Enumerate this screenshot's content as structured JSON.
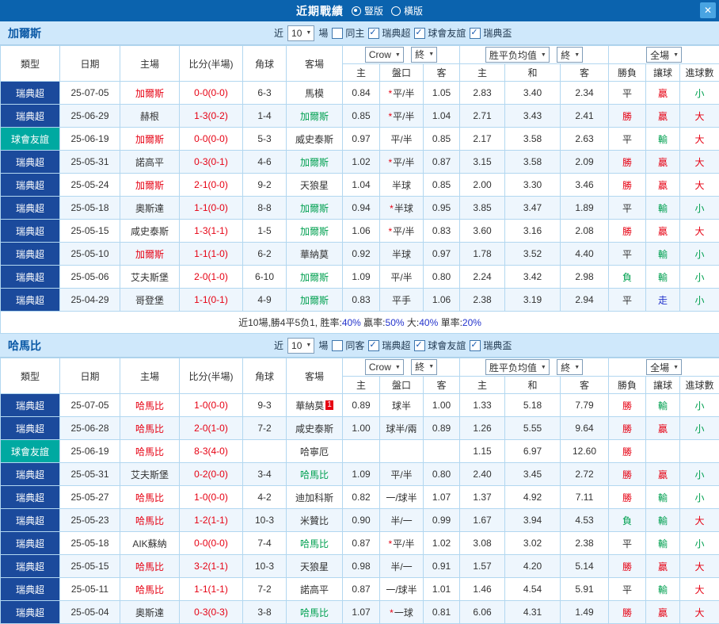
{
  "titlebar": {
    "title": "近期戰績",
    "options": [
      {
        "label": "豎版",
        "selected": true
      },
      {
        "label": "橫版",
        "selected": false
      }
    ],
    "close_label": "✕"
  },
  "filters": {
    "company": "Crow",
    "final_a": "終",
    "avg": "胜平负均值",
    "final_b": "終",
    "scope": "全場"
  },
  "headers": {
    "type": "類型",
    "date": "日期",
    "home": "主場",
    "score": "比分(半場)",
    "corner": "角球",
    "away": "客場",
    "o_home": "主",
    "o_handicap": "盤口",
    "o_away": "客",
    "a_home": "主",
    "a_draw": "和",
    "a_away": "客",
    "result": "勝負",
    "let_ball": "讓球",
    "goals": "進球數"
  },
  "sections": [
    {
      "team": "加爾斯",
      "near": "近",
      "count": "10",
      "unit": "場",
      "same": {
        "label": "同主",
        "checked": false
      },
      "leagues": [
        {
          "label": "瑞典超",
          "checked": true
        },
        {
          "label": "球會友誼",
          "checked": true
        },
        {
          "label": "瑞典盃",
          "checked": true
        }
      ],
      "rows": [
        {
          "league": "瑞典超",
          "friendly": false,
          "date": "25-07-05",
          "home": "加爾斯",
          "home_focus": true,
          "score": "0-0(0-0)",
          "corner": "6-3",
          "away": "馬模",
          "away_focus": false,
          "o": [
            "0.84",
            "*平/半",
            "1.05"
          ],
          "a": [
            "2.83",
            "3.40",
            "2.34"
          ],
          "res": "平",
          "let": "贏",
          "goal": "小"
        },
        {
          "league": "瑞典超",
          "friendly": false,
          "date": "25-06-29",
          "home": "赫根",
          "home_focus": false,
          "score": "1-3(0-2)",
          "corner": "1-4",
          "away": "加爾斯",
          "away_focus": true,
          "o": [
            "0.85",
            "*平/半",
            "1.04"
          ],
          "a": [
            "2.71",
            "3.43",
            "2.41"
          ],
          "res": "勝",
          "let": "贏",
          "goal": "大"
        },
        {
          "league": "球會友誼",
          "friendly": true,
          "date": "25-06-19",
          "home": "加爾斯",
          "home_focus": true,
          "score": "0-0(0-0)",
          "corner": "5-3",
          "away": "威史泰斯",
          "away_focus": false,
          "o": [
            "0.97",
            "平/半",
            "0.85"
          ],
          "a": [
            "2.17",
            "3.58",
            "2.63"
          ],
          "res": "平",
          "let": "輸",
          "goal": "大"
        },
        {
          "league": "瑞典超",
          "friendly": false,
          "date": "25-05-31",
          "home": "諾高平",
          "home_focus": false,
          "score": "0-3(0-1)",
          "corner": "4-6",
          "away": "加爾斯",
          "away_focus": true,
          "o": [
            "1.02",
            "*平/半",
            "0.87"
          ],
          "a": [
            "3.15",
            "3.58",
            "2.09"
          ],
          "res": "勝",
          "let": "贏",
          "goal": "大"
        },
        {
          "league": "瑞典超",
          "friendly": false,
          "date": "25-05-24",
          "home": "加爾斯",
          "home_focus": true,
          "score": "2-1(0-0)",
          "corner": "9-2",
          "away": "天狼星",
          "away_focus": false,
          "o": [
            "1.04",
            "半球",
            "0.85"
          ],
          "a": [
            "2.00",
            "3.30",
            "3.46"
          ],
          "res": "勝",
          "let": "贏",
          "goal": "大"
        },
        {
          "league": "瑞典超",
          "friendly": false,
          "date": "25-05-18",
          "home": "奧斯達",
          "home_focus": false,
          "score": "1-1(0-0)",
          "corner": "8-8",
          "away": "加爾斯",
          "away_focus": true,
          "o": [
            "0.94",
            "*半球",
            "0.95"
          ],
          "a": [
            "3.85",
            "3.47",
            "1.89"
          ],
          "res": "平",
          "let": "輸",
          "goal": "小"
        },
        {
          "league": "瑞典超",
          "friendly": false,
          "date": "25-05-15",
          "home": "咸史泰斯",
          "home_focus": false,
          "score": "1-3(1-1)",
          "corner": "1-5",
          "away": "加爾斯",
          "away_focus": true,
          "o": [
            "1.06",
            "*平/半",
            "0.83"
          ],
          "a": [
            "3.60",
            "3.16",
            "2.08"
          ],
          "res": "勝",
          "let": "贏",
          "goal": "大"
        },
        {
          "league": "瑞典超",
          "friendly": false,
          "date": "25-05-10",
          "home": "加爾斯",
          "home_focus": true,
          "score": "1-1(1-0)",
          "corner": "6-2",
          "away": "華納莫",
          "away_focus": false,
          "o": [
            "0.92",
            "半球",
            "0.97"
          ],
          "a": [
            "1.78",
            "3.52",
            "4.40"
          ],
          "res": "平",
          "let": "輸",
          "goal": "小"
        },
        {
          "league": "瑞典超",
          "friendly": false,
          "date": "25-05-06",
          "home": "艾夫斯堡",
          "home_focus": false,
          "score": "2-0(1-0)",
          "corner": "6-10",
          "away": "加爾斯",
          "away_focus": true,
          "o": [
            "1.09",
            "平/半",
            "0.80"
          ],
          "a": [
            "2.24",
            "3.42",
            "2.98"
          ],
          "res": "負",
          "let": "輸",
          "goal": "小"
        },
        {
          "league": "瑞典超",
          "friendly": false,
          "date": "25-04-29",
          "home": "哥登堡",
          "home_focus": false,
          "score": "1-1(0-1)",
          "corner": "4-9",
          "away": "加爾斯",
          "away_focus": true,
          "o": [
            "0.83",
            "平手",
            "1.06"
          ],
          "a": [
            "2.38",
            "3.19",
            "2.94"
          ],
          "res": "平",
          "let": "走",
          "goal": "小"
        }
      ],
      "summary": [
        {
          "text": "近10場,勝4平5负1, 胜率:",
          "blue": false
        },
        {
          "text": "40%",
          "blue": true
        },
        {
          "text": " 贏率:",
          "blue": false
        },
        {
          "text": "50%",
          "blue": true
        },
        {
          "text": " 大:",
          "blue": false
        },
        {
          "text": "40%",
          "blue": true
        },
        {
          "text": " 單率:",
          "blue": false
        },
        {
          "text": "20%",
          "blue": true
        }
      ]
    },
    {
      "team": "哈馬比",
      "near": "近",
      "count": "10",
      "unit": "場",
      "same": {
        "label": "同客",
        "checked": false
      },
      "leagues": [
        {
          "label": "瑞典超",
          "checked": true
        },
        {
          "label": "球會友誼",
          "checked": true
        },
        {
          "label": "瑞典盃",
          "checked": true
        }
      ],
      "rows": [
        {
          "league": "瑞典超",
          "friendly": false,
          "date": "25-07-05",
          "home": "哈馬比",
          "home_focus": true,
          "score": "1-0(0-0)",
          "corner": "9-3",
          "away": "華納莫",
          "away_focus": false,
          "away_card": "1",
          "o": [
            "0.89",
            "球半",
            "1.00"
          ],
          "a": [
            "1.33",
            "5.18",
            "7.79"
          ],
          "res": "勝",
          "let": "輸",
          "goal": "小"
        },
        {
          "league": "瑞典超",
          "friendly": false,
          "date": "25-06-28",
          "home": "哈馬比",
          "home_focus": true,
          "score": "2-0(1-0)",
          "corner": "7-2",
          "away": "咸史泰斯",
          "away_focus": false,
          "o": [
            "1.00",
            "球半/兩",
            "0.89"
          ],
          "a": [
            "1.26",
            "5.55",
            "9.64"
          ],
          "res": "勝",
          "let": "贏",
          "goal": "小"
        },
        {
          "league": "球會友誼",
          "friendly": true,
          "date": "25-06-19",
          "home": "哈馬比",
          "home_focus": true,
          "score": "8-3(4-0)",
          "corner": "",
          "away": "哈寧厄",
          "away_focus": false,
          "o": [
            "",
            "",
            ""
          ],
          "a": [
            "1.15",
            "6.97",
            "12.60"
          ],
          "res": "勝",
          "let": "",
          "goal": ""
        },
        {
          "league": "瑞典超",
          "friendly": false,
          "date": "25-05-31",
          "home": "艾夫斯堡",
          "home_focus": false,
          "score": "0-2(0-0)",
          "corner": "3-4",
          "away": "哈馬比",
          "away_focus": true,
          "o": [
            "1.09",
            "平/半",
            "0.80"
          ],
          "a": [
            "2.40",
            "3.45",
            "2.72"
          ],
          "res": "勝",
          "let": "贏",
          "goal": "小"
        },
        {
          "league": "瑞典超",
          "friendly": false,
          "date": "25-05-27",
          "home": "哈馬比",
          "home_focus": true,
          "score": "1-0(0-0)",
          "corner": "4-2",
          "away": "迪加科斯",
          "away_focus": false,
          "o": [
            "0.82",
            "一/球半",
            "1.07"
          ],
          "a": [
            "1.37",
            "4.92",
            "7.11"
          ],
          "res": "勝",
          "let": "輸",
          "goal": "小"
        },
        {
          "league": "瑞典超",
          "friendly": false,
          "date": "25-05-23",
          "home": "哈馬比",
          "home_focus": true,
          "score": "1-2(1-1)",
          "corner": "10-3",
          "away": "米贊比",
          "away_focus": false,
          "o": [
            "0.90",
            "半/一",
            "0.99"
          ],
          "a": [
            "1.67",
            "3.94",
            "4.53"
          ],
          "res": "負",
          "let": "輸",
          "goal": "大"
        },
        {
          "league": "瑞典超",
          "friendly": false,
          "date": "25-05-18",
          "home": "AIK蘇納",
          "home_focus": false,
          "score": "0-0(0-0)",
          "corner": "7-4",
          "away": "哈馬比",
          "away_focus": true,
          "o": [
            "0.87",
            "*平/半",
            "1.02"
          ],
          "a": [
            "3.08",
            "3.02",
            "2.38"
          ],
          "res": "平",
          "let": "輸",
          "goal": "小"
        },
        {
          "league": "瑞典超",
          "friendly": false,
          "date": "25-05-15",
          "home": "哈馬比",
          "home_focus": true,
          "score": "3-2(1-1)",
          "corner": "10-3",
          "away": "天狼星",
          "away_focus": false,
          "o": [
            "0.98",
            "半/一",
            "0.91"
          ],
          "a": [
            "1.57",
            "4.20",
            "5.14"
          ],
          "res": "勝",
          "let": "贏",
          "goal": "大"
        },
        {
          "league": "瑞典超",
          "friendly": false,
          "date": "25-05-11",
          "home": "哈馬比",
          "home_focus": true,
          "score": "1-1(1-1)",
          "corner": "7-2",
          "away": "諾高平",
          "away_focus": false,
          "o": [
            "0.87",
            "一/球半",
            "1.01"
          ],
          "a": [
            "1.46",
            "4.54",
            "5.91"
          ],
          "res": "平",
          "let": "輸",
          "goal": "大"
        },
        {
          "league": "瑞典超",
          "friendly": false,
          "date": "25-05-04",
          "home": "奧斯達",
          "home_focus": false,
          "score": "0-3(0-3)",
          "corner": "3-8",
          "away": "哈馬比",
          "away_focus": true,
          "o": [
            "1.07",
            "*一球",
            "0.81"
          ],
          "a": [
            "6.06",
            "4.31",
            "1.49"
          ],
          "res": "勝",
          "let": "贏",
          "goal": "大"
        }
      ],
      "summary": null
    }
  ]
}
